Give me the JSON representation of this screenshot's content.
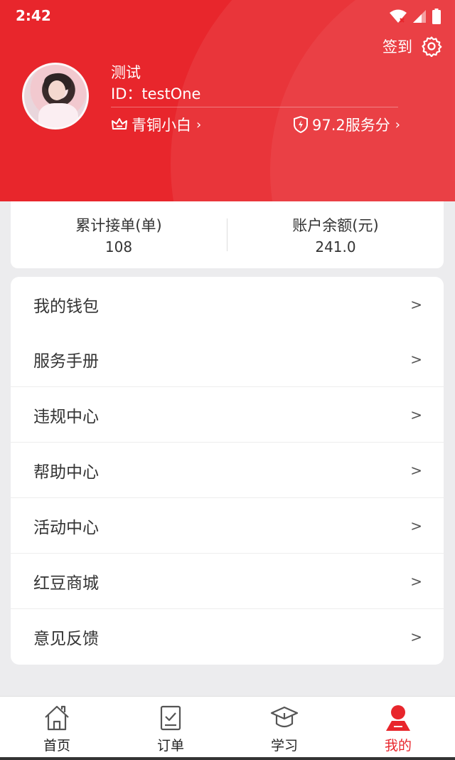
{
  "status_bar": {
    "time": "2:42"
  },
  "header": {
    "checkin_label": "签到",
    "user_name": "测试",
    "user_id": "ID：testOne",
    "level_label": "青铜小白",
    "score_label": "97.2服务分"
  },
  "stats": {
    "orders_label": "累计接单(单)",
    "orders_value": "108",
    "balance_label": "账户余额(元)",
    "balance_value": "241.0"
  },
  "menu": {
    "items": [
      {
        "label": "我的钱包"
      },
      {
        "label": "服务手册"
      },
      {
        "label": "违规中心"
      },
      {
        "label": "帮助中心"
      },
      {
        "label": "活动中心"
      },
      {
        "label": "红豆商城"
      },
      {
        "label": "意见反馈"
      }
    ]
  },
  "bottom_nav": {
    "items": [
      {
        "label": "首页",
        "icon": "home-icon"
      },
      {
        "label": "订单",
        "icon": "order-icon"
      },
      {
        "label": "学习",
        "icon": "graduation-cap-icon"
      },
      {
        "label": "我的",
        "icon": "profile-icon"
      }
    ],
    "active_color": "#e8262c"
  },
  "colors": {
    "brand_red": "#e8262c",
    "page_bg": "#ececee"
  }
}
